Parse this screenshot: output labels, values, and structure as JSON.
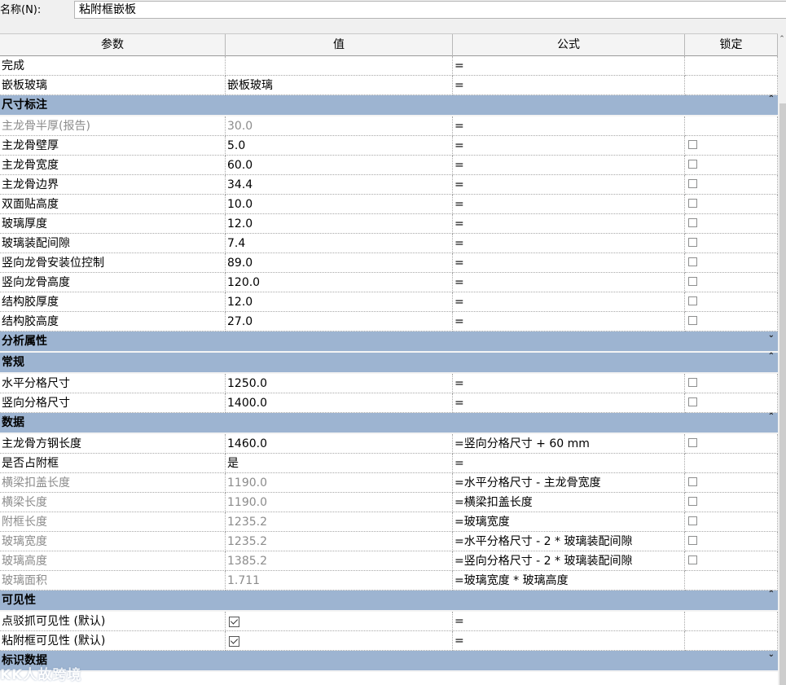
{
  "name_field": {
    "label": "名称(N):",
    "value": "粘附框嵌板"
  },
  "columns": {
    "param": "参数",
    "value": "值",
    "formula": "公式",
    "lock": "锁定"
  },
  "rows": [
    {
      "type": "param",
      "name": "完成",
      "value": "",
      "formula": "=",
      "lock": "none",
      "grey": false
    },
    {
      "type": "param",
      "name": "嵌板玻璃",
      "value": "嵌板玻璃",
      "formula": "=",
      "lock": "none",
      "grey": false
    },
    {
      "type": "group",
      "name": "尺寸标注",
      "icon": "chevron-up-icon",
      "glyph": "⌃"
    },
    {
      "type": "param",
      "name": "主龙骨半厚(报告)",
      "value": "30.0",
      "formula": "=",
      "lock": "none",
      "grey": true
    },
    {
      "type": "param",
      "name": "主龙骨壁厚",
      "value": "5.0",
      "formula": "=",
      "lock": "checkbox",
      "grey": false
    },
    {
      "type": "param",
      "name": "主龙骨宽度",
      "value": "60.0",
      "formula": "=",
      "lock": "checkbox",
      "grey": false
    },
    {
      "type": "param",
      "name": "主龙骨边界",
      "value": "34.4",
      "formula": "=",
      "lock": "checkbox",
      "grey": false
    },
    {
      "type": "param",
      "name": "双面贴高度",
      "value": "10.0",
      "formula": "=",
      "lock": "checkbox",
      "grey": false
    },
    {
      "type": "param",
      "name": "玻璃厚度",
      "value": "12.0",
      "formula": "=",
      "lock": "checkbox",
      "grey": false
    },
    {
      "type": "param",
      "name": "玻璃装配间隙",
      "value": "7.4",
      "formula": "=",
      "lock": "checkbox",
      "grey": false
    },
    {
      "type": "param",
      "name": "竖向龙骨安装位控制",
      "value": "89.0",
      "formula": "=",
      "lock": "checkbox",
      "grey": false
    },
    {
      "type": "param",
      "name": "竖向龙骨高度",
      "value": "120.0",
      "formula": "=",
      "lock": "checkbox",
      "grey": false
    },
    {
      "type": "param",
      "name": "结构胶厚度",
      "value": "12.0",
      "formula": "=",
      "lock": "checkbox",
      "grey": false
    },
    {
      "type": "param",
      "name": "结构胶高度",
      "value": "27.0",
      "formula": "=",
      "lock": "checkbox",
      "grey": false
    },
    {
      "type": "group",
      "name": "分析属性",
      "icon": "chevron-down-icon",
      "glyph": "⌄"
    },
    {
      "type": "group",
      "name": "常规",
      "icon": "chevron-up-icon",
      "glyph": "⌃"
    },
    {
      "type": "param",
      "name": "水平分格尺寸",
      "value": "1250.0",
      "formula": "=",
      "lock": "checkbox",
      "grey": false
    },
    {
      "type": "param",
      "name": "竖向分格尺寸",
      "value": "1400.0",
      "formula": "=",
      "lock": "checkbox",
      "grey": false
    },
    {
      "type": "group",
      "name": "数据",
      "icon": "chevron-up-icon",
      "glyph": "⌃"
    },
    {
      "type": "param",
      "name": "主龙骨方钢长度",
      "value": "1460.0",
      "formula": "=竖向分格尺寸 + 60 mm",
      "lock": "checkbox",
      "grey": false
    },
    {
      "type": "param",
      "name": "是否占附框",
      "value": "是",
      "formula": "=",
      "lock": "none",
      "grey": false
    },
    {
      "type": "param",
      "name": "横梁扣盖长度",
      "value": "1190.0",
      "formula": "=水平分格尺寸 - 主龙骨宽度",
      "lock": "checkbox",
      "grey": true
    },
    {
      "type": "param",
      "name": "横梁长度",
      "value": "1190.0",
      "formula": "=横梁扣盖长度",
      "lock": "checkbox",
      "grey": true
    },
    {
      "type": "param",
      "name": "附框长度",
      "value": "1235.2",
      "formula": "=玻璃宽度",
      "lock": "checkbox",
      "grey": true
    },
    {
      "type": "param",
      "name": "玻璃宽度",
      "value": "1235.2",
      "formula": "=水平分格尺寸 - 2 * 玻璃装配间隙",
      "lock": "checkbox",
      "grey": true
    },
    {
      "type": "param",
      "name": "玻璃高度",
      "value": "1385.2",
      "formula": "=竖向分格尺寸 - 2 * 玻璃装配间隙",
      "lock": "checkbox",
      "grey": true
    },
    {
      "type": "param",
      "name": "玻璃面积",
      "value": "1.711",
      "formula": "=玻璃宽度 * 玻璃高度",
      "lock": "none",
      "grey": true
    },
    {
      "type": "group",
      "name": "可见性",
      "icon": "chevron-up-icon",
      "glyph": "⌃"
    },
    {
      "type": "param",
      "name": "点驳抓可见性 (默认)",
      "value": "",
      "valueCheck": true,
      "formula": "=",
      "lock": "none",
      "grey": false
    },
    {
      "type": "param",
      "name": "粘附框可见性 (默认)",
      "value": "",
      "valueCheck": true,
      "formula": "=",
      "lock": "none",
      "grey": false
    },
    {
      "type": "group",
      "name": "标识数据",
      "icon": "chevron-down-icon",
      "glyph": "⌄"
    }
  ],
  "watermark": "KK人故跨境",
  "colors": {
    "group_bg": "#9db4d1",
    "grey_text": "#8c8c8c"
  }
}
